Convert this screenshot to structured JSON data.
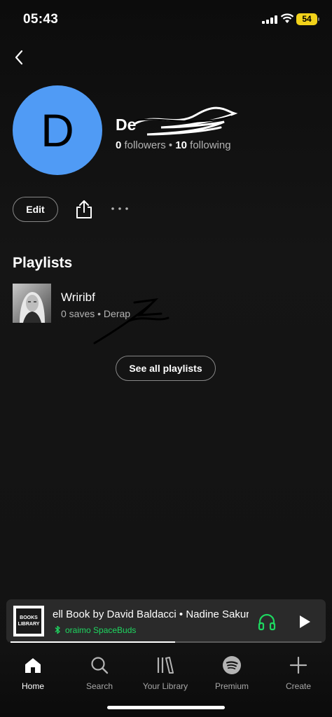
{
  "status_bar": {
    "time": "05:43",
    "battery": "54"
  },
  "profile": {
    "avatar_letter": "D",
    "name": "De",
    "followers_count": "0",
    "followers_label": "followers",
    "separator": "•",
    "following_count": "10",
    "following_label": "following"
  },
  "actions": {
    "edit_label": "Edit"
  },
  "playlists": {
    "title": "Playlists",
    "items": [
      {
        "name": "Wriribf",
        "meta": "0 saves • Derap"
      }
    ],
    "see_all_label": "See all playlists"
  },
  "now_playing": {
    "cover_text": "BOOKS LIBRARY",
    "title": "ell Book by David Baldacci • Nadine Sakura",
    "device": "oraimo SpaceBuds",
    "progress": 0.53
  },
  "nav": {
    "items": [
      {
        "label": "Home",
        "icon": "home-icon",
        "active": true
      },
      {
        "label": "Search",
        "icon": "search-icon",
        "active": false
      },
      {
        "label": "Your Library",
        "icon": "library-icon",
        "active": false
      },
      {
        "label": "Premium",
        "icon": "spotify-icon",
        "active": false
      },
      {
        "label": "Create",
        "icon": "plus-icon",
        "active": false
      }
    ]
  },
  "colors": {
    "background": "#121212",
    "avatar": "#509bf5",
    "accent_green": "#1ed760",
    "battery": "#f2d21a"
  }
}
